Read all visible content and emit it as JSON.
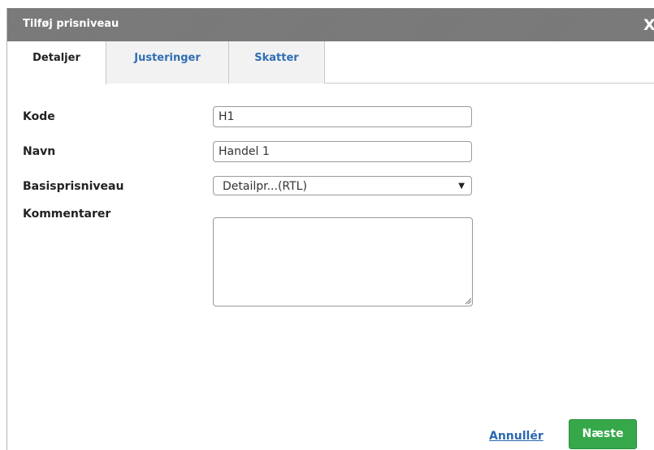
{
  "dialog": {
    "title": "Tilføj prisniveau",
    "close_label": "X"
  },
  "tabs": [
    {
      "label": "Detaljer",
      "active": true
    },
    {
      "label": "Justeringer",
      "active": false
    },
    {
      "label": "Skatter",
      "active": false
    }
  ],
  "form": {
    "code": {
      "label": "Kode",
      "value": "H1"
    },
    "name": {
      "label": "Navn",
      "value": "Handel 1"
    },
    "base_level": {
      "label": "Basisprisniveau",
      "value": "Detailpr...(RTL)"
    },
    "comments": {
      "label": "Kommentarer",
      "value": ""
    }
  },
  "footer": {
    "cancel_label": "Annullér",
    "next_label": "Næste"
  },
  "colors": {
    "title_bar": "#787878",
    "link": "#2a67b0",
    "primary_button": "#36a84a"
  },
  "icons": {
    "close": "close-icon",
    "dropdown": "chevron-down-icon",
    "resize": "resize-grip-icon"
  }
}
